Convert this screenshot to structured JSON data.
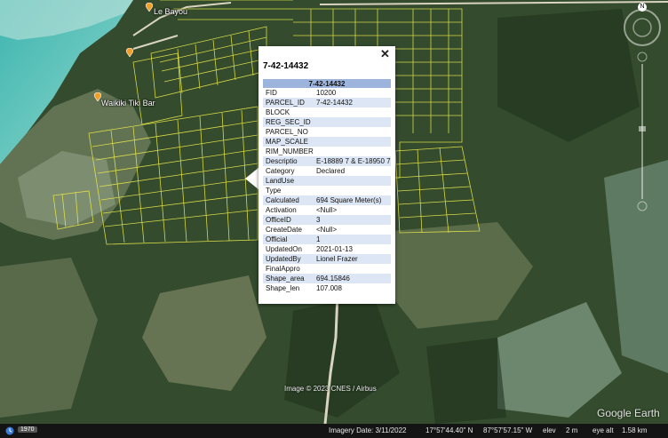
{
  "places": [
    {
      "label": "Le Bayou"
    },
    {
      "label": "Waikiki Tiki Bar"
    }
  ],
  "popup": {
    "title": "7-42-14432",
    "table_header": "7-42-14432",
    "rows": [
      {
        "key": "FID",
        "value": "10200"
      },
      {
        "key": "PARCEL_ID",
        "value": "7-42-14432"
      },
      {
        "key": "BLOCK",
        "value": ""
      },
      {
        "key": "REG_SEC_ID",
        "value": ""
      },
      {
        "key": "PARCEL_NO",
        "value": ""
      },
      {
        "key": "MAP_SCALE",
        "value": ""
      },
      {
        "key": "RIM_NUMBER",
        "value": ""
      },
      {
        "key": "Descriptio",
        "value": "E-18889 7 & E-18950 7"
      },
      {
        "key": "Category",
        "value": "Declared"
      },
      {
        "key": "LandUse",
        "value": ""
      },
      {
        "key": "Type",
        "value": ""
      },
      {
        "key": "Calculated",
        "value": "694 Square Meter(s)"
      },
      {
        "key": "Activation",
        "value": "<Null>"
      },
      {
        "key": "OfficeID",
        "value": "3"
      },
      {
        "key": "CreateDate",
        "value": "<Null>"
      },
      {
        "key": "Official",
        "value": "1"
      },
      {
        "key": "UpdatedOn",
        "value": "2021-01-13"
      },
      {
        "key": "UpdatedBy",
        "value": "Lionel Frazer"
      },
      {
        "key": "FinalAppro",
        "value": ""
      },
      {
        "key": "Shape_area",
        "value": "694.15846"
      },
      {
        "key": "Shape_len",
        "value": "107.008"
      }
    ]
  },
  "credit": "Image © 2023 CNES / Airbus",
  "logo": "Google Earth",
  "status": {
    "imagery_date": "Imagery Date: 3/11/2022",
    "lat": "17°57'44.40\" N",
    "lon": "87°57'57.15\" W",
    "elev_label": "elev",
    "elev_value": "2 m",
    "eye_alt_label": "eye alt",
    "eye_alt_value": "1.58 km"
  },
  "timeline": {
    "year": "1970"
  },
  "compass": {
    "north": "N"
  },
  "colors": {
    "parcel_lines": "#e8e84a",
    "pin": "#f0a028",
    "table_header": "#9db4dd"
  }
}
